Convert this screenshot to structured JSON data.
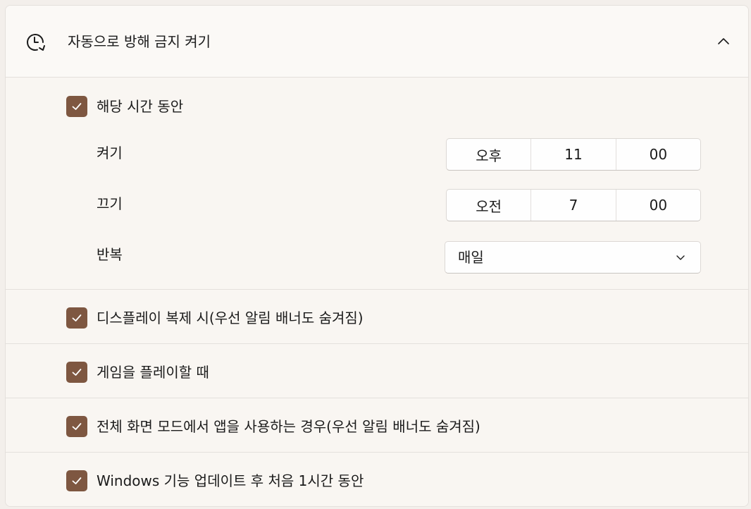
{
  "header": {
    "title": "자동으로 방해 금지 켜기",
    "icon": "clock-icon",
    "toggle_icon": "chevron-up-icon"
  },
  "schedule": {
    "checked": true,
    "label": "해당 시간 동안",
    "turn_on": {
      "label": "켜기",
      "period": "오후",
      "hour": "11",
      "minute": "00"
    },
    "turn_off": {
      "label": "끄기",
      "period": "오전",
      "hour": "7",
      "minute": "00"
    },
    "repeat": {
      "label": "반복",
      "value": "매일"
    }
  },
  "options": [
    {
      "checked": true,
      "label": "디스플레이 복제 시(우선 알림 배너도 숨겨짐)"
    },
    {
      "checked": true,
      "label": "게임을 플레이할 때"
    },
    {
      "checked": true,
      "label": "전체 화면 모드에서 앱을 사용하는 경우(우선 알림 배너도 숨겨짐)"
    },
    {
      "checked": true,
      "label": "Windows 기능 업데이트 후 처음 1시간 동안"
    }
  ],
  "colors": {
    "accent": "#7e5741"
  }
}
